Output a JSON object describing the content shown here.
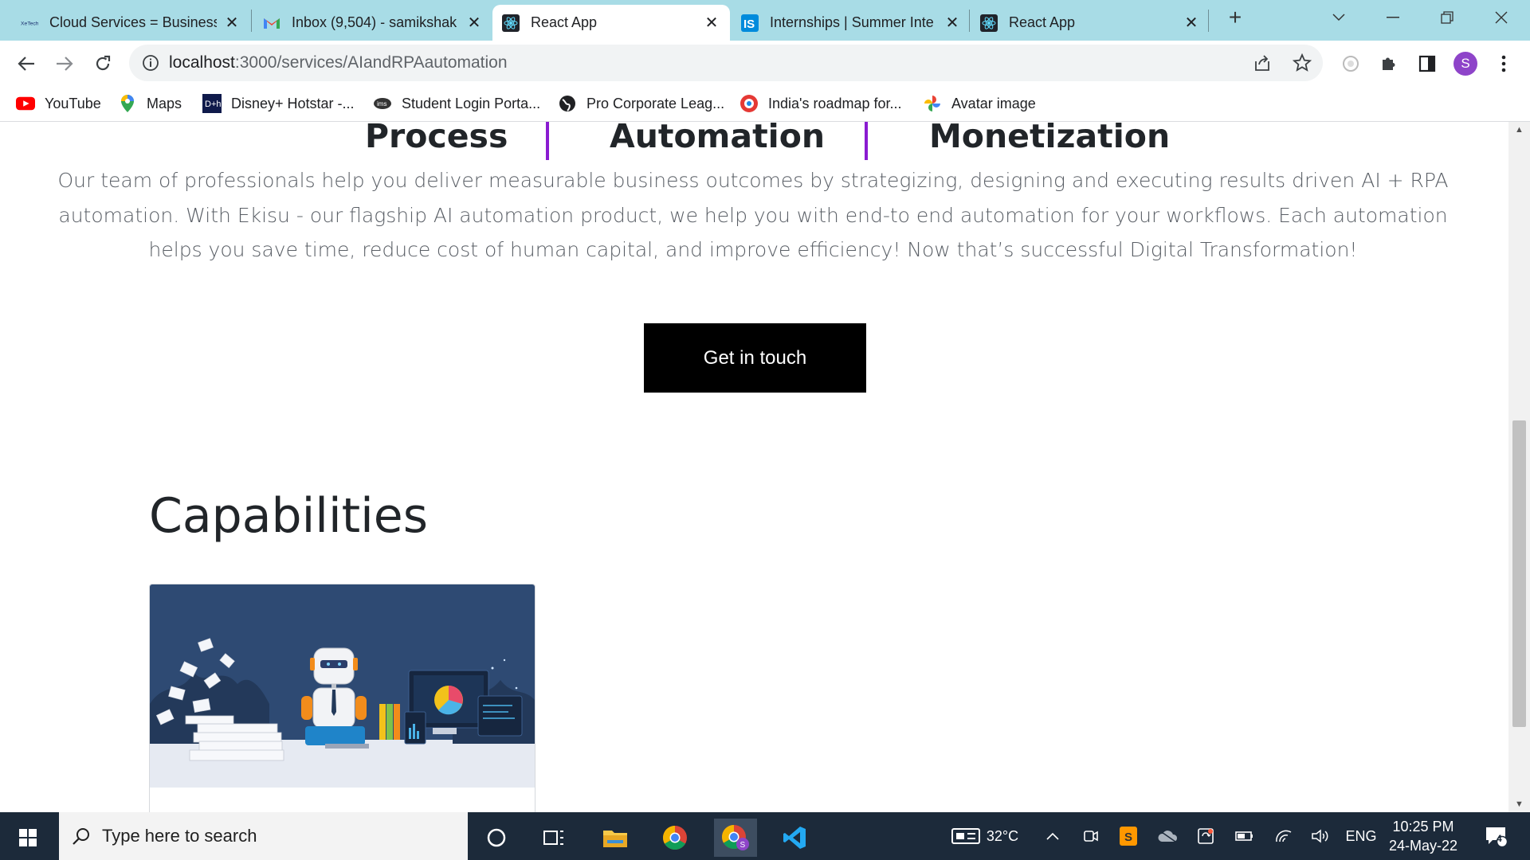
{
  "browser": {
    "tabs": [
      {
        "title": "Cloud Services = Business",
        "favicon": "xtech-logo-icon",
        "active": false
      },
      {
        "title": "Inbox (9,504) - samikshak",
        "favicon": "gmail-icon",
        "active": false
      },
      {
        "title": "React App",
        "favicon": "react-icon",
        "active": true
      },
      {
        "title": "Internships | Summer Inte",
        "favicon": "internshala-icon",
        "active": false
      },
      {
        "title": "React App",
        "favicon": "react-icon",
        "active": false
      }
    ],
    "new_tab_label": "+",
    "url_host": "localhost",
    "url_path": ":3000/services/AIandRPAautomation",
    "profile_initial": "S",
    "bookmarks": [
      {
        "label": "YouTube",
        "icon": "youtube-icon"
      },
      {
        "label": "Maps",
        "icon": "maps-pin-icon"
      },
      {
        "label": "Disney+ Hotstar -...",
        "icon": "hotstar-icon"
      },
      {
        "label": "Student Login Porta...",
        "icon": "ims-icon"
      },
      {
        "label": "Pro Corporate Leag...",
        "icon": "globe-icon"
      },
      {
        "label": "India's roadmap for...",
        "icon": "roadmap-icon"
      },
      {
        "label": "Avatar image",
        "icon": "pinwheel-icon"
      }
    ]
  },
  "page": {
    "pillars": [
      "Process",
      "Automation",
      "Monetization"
    ],
    "description": "Our team of professionals help you deliver measurable business outcomes by strategizing, designing and executing results driven AI + RPA automation. With Ekisu - our flagship AI automation product, we help you with end-to end automation for your workflows. Each automation helps you save time, reduce cost of human capital, and improve efficiency! Now that’s successful Digital Transformation!",
    "cta_label": "Get in touch",
    "capabilities_title": "Capabilities",
    "colors": {
      "accent_bar": "#8a1bd1",
      "cta_bg": "#000000",
      "card_art_bg": "#2e4a73"
    }
  },
  "taskbar": {
    "search_placeholder": "Type here to search",
    "weather": "32°C",
    "language": "ENG",
    "time": "10:25 PM",
    "date": "24-May-22",
    "notification_count": "4"
  }
}
